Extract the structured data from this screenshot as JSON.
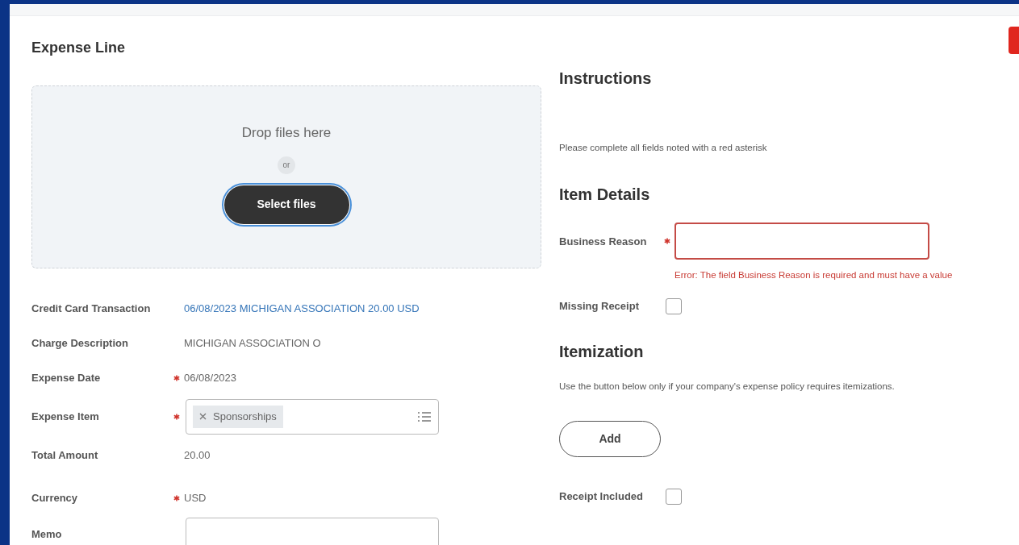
{
  "header": {
    "title": "Expense Line"
  },
  "upload": {
    "prompt": "Drop files here",
    "separator": "or",
    "button": "Select files"
  },
  "fields": [
    {
      "kind": "link",
      "label": "Credit Card Transaction",
      "required": false,
      "value": "06/08/2023 MICHIGAN ASSOCIATION 20.00 USD"
    },
    {
      "kind": "text",
      "label": "Charge Description",
      "required": false,
      "value": "MICHIGAN ASSOCIATION O"
    },
    {
      "kind": "text",
      "label": "Expense Date",
      "required": true,
      "value": "06/08/2023"
    },
    {
      "kind": "select",
      "label": "Expense Item",
      "required": true,
      "tags": [
        "Sponsorships"
      ]
    },
    {
      "kind": "text",
      "label": "Total Amount",
      "required": false,
      "value": "20.00"
    },
    {
      "kind": "text",
      "label": "Currency",
      "required": true,
      "value": "USD"
    },
    {
      "kind": "textarea",
      "label": "Memo",
      "required": false
    }
  ],
  "instructions": {
    "title": "Instructions",
    "text": "Please complete all fields noted with a red asterisk"
  },
  "item_details": {
    "title": "Item Details",
    "fields": [
      {
        "kind": "input",
        "label": "Business Reason",
        "required": true,
        "error": "Error: The field Business Reason is required and must have a value"
      },
      {
        "kind": "checkbox",
        "label": "Missing Receipt",
        "required": false,
        "checked": false
      }
    ]
  },
  "itemization": {
    "title": "Itemization",
    "text": "Use the button below only if your company's expense policy requires itemizations.",
    "button": "Add",
    "fields": [
      {
        "kind": "checkbox",
        "label": "Receipt Included",
        "required": false,
        "checked": false
      }
    ]
  }
}
